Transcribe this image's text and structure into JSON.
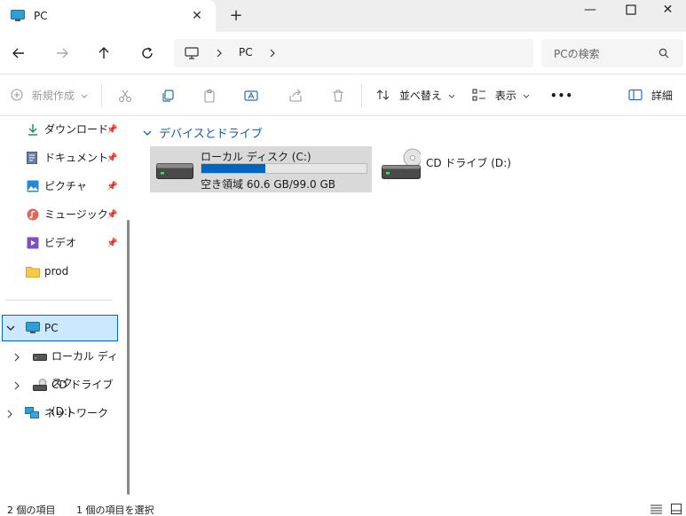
{
  "window": {
    "tab_title": "PC",
    "tab_close": "✕",
    "new_tab": "+",
    "minimize": "—",
    "close": "✕"
  },
  "address": {
    "crumb": "PC",
    "search_placeholder": "PCの検索"
  },
  "commands": {
    "new": "新規作成",
    "sort": "並べ替え",
    "view": "表示",
    "more": "•••",
    "details": "詳細"
  },
  "sidebar": {
    "quick": [
      {
        "label": "ダウンロード",
        "icon": "download-icon"
      },
      {
        "label": "ドキュメント",
        "icon": "document-icon"
      },
      {
        "label": "ピクチャ",
        "icon": "picture-icon"
      },
      {
        "label": "ミュージック",
        "icon": "music-icon"
      },
      {
        "label": "ビデオ",
        "icon": "video-icon"
      },
      {
        "label": "prod",
        "icon": "folder-icon"
      }
    ],
    "pc": "PC",
    "local_disk": "ローカル ディスク",
    "cd_drive": "CD ドライブ (D:)",
    "network": "ネットワーク"
  },
  "content": {
    "group": "デバイスとドライブ",
    "drives": [
      {
        "name": "ローカル ディスク (C:)",
        "space": "空き領域 60.6 GB/99.0 GB",
        "used_fraction": 0.388
      },
      {
        "name": "CD ドライブ (D:)"
      }
    ]
  },
  "status": {
    "count": "2 個の項目",
    "selected": "1 個の項目を選択"
  },
  "colors": {
    "accent": "#0067c0",
    "selection": "#cce8ff",
    "selection_border": "#0067c0"
  }
}
